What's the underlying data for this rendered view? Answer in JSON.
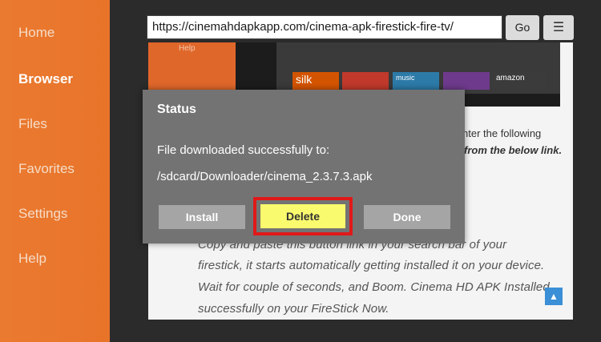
{
  "sidebar": {
    "items": [
      {
        "label": "Home",
        "active": false
      },
      {
        "label": "Browser",
        "active": true
      },
      {
        "label": "Files",
        "active": false
      },
      {
        "label": "Favorites",
        "active": false
      },
      {
        "label": "Settings",
        "active": false
      },
      {
        "label": "Help",
        "active": false
      }
    ]
  },
  "toolbar": {
    "url": "https://cinemahdapkapp.com/cinema-apk-firestick-fire-tv/",
    "go_label": "Go",
    "menu_icon": "hamburger-menu-icon"
  },
  "webpage": {
    "image": {
      "help_label": "Help",
      "tiles": [
        "silk",
        "music",
        "amazon"
      ]
    },
    "snippet_right_1": "nter the following",
    "snippet_right_2": "from the below link.",
    "paragraph_lines": [
      "Copy and paste this button link in your search bar of your",
      "firestick, it starts automatically getting installed it on your device.",
      "Wait for couple of seconds, and Boom. Cinema HD APK Installed",
      "successfully on your FireStick Now."
    ]
  },
  "dialog": {
    "title": "Status",
    "message": "File downloaded successfully to:",
    "path": "/sdcard/Downloader/cinema_2.3.7.3.apk",
    "buttons": {
      "install": "Install",
      "delete": "Delete",
      "done": "Done"
    }
  },
  "colors": {
    "sidebar": "#e8742a",
    "dialog": "#737373",
    "highlight": "#e01919",
    "delete_button": "#fafa6e"
  }
}
